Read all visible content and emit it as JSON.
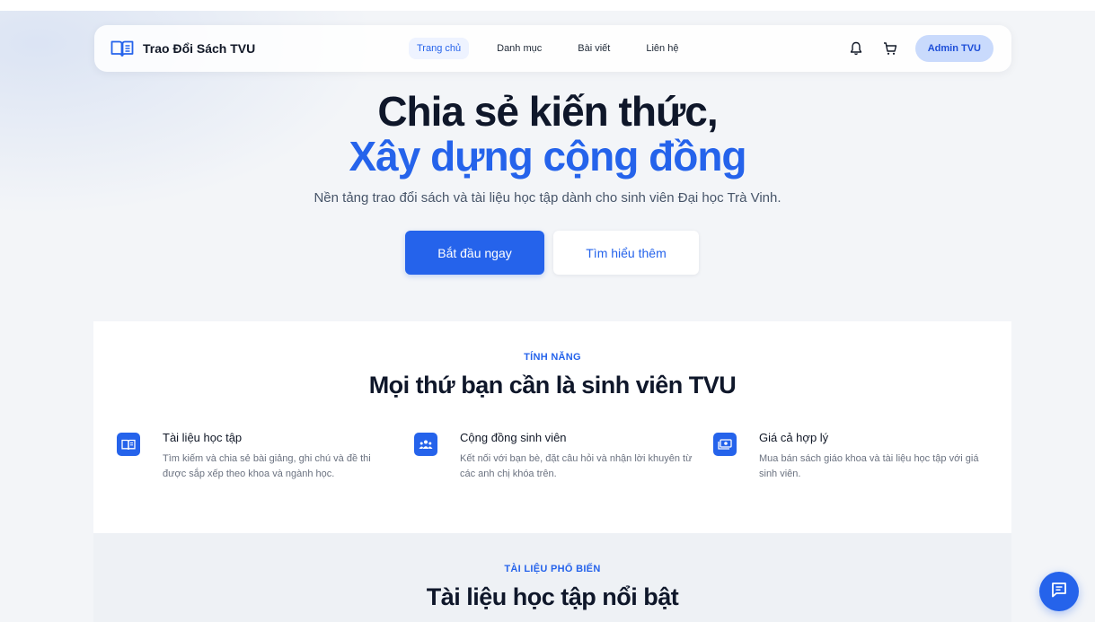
{
  "brand": {
    "name": "Trao Đổi Sách TVU",
    "icon": "book-open-icon"
  },
  "nav": {
    "links": [
      {
        "label": "Trang chủ",
        "active": true
      },
      {
        "label": "Danh mục",
        "active": false
      },
      {
        "label": "Bài viết",
        "active": false
      },
      {
        "label": "Liên hệ",
        "active": false
      }
    ],
    "notification_icon": "bell-icon",
    "cart_icon": "cart-icon",
    "user_label": "Admin TVU"
  },
  "hero": {
    "title_line1": "Chia sẻ kiến thức,",
    "title_line2": "Xây dựng cộng đồng",
    "subtitle": "Nền tảng trao đổi sách và tài liệu học tập dành cho sinh viên Đại học Trà Vinh.",
    "primary_button": "Bắt đầu ngay",
    "secondary_button": "Tìm hiểu thêm"
  },
  "features": {
    "eyebrow": "TÍNH NĂNG",
    "title": "Mọi thứ bạn cần là sinh viên TVU",
    "items": [
      {
        "icon": "book-icon",
        "title": "Tài liệu học tập",
        "desc": "Tìm kiếm và chia sẻ bài giảng, ghi chú và đề thi được sắp xếp theo khoa và ngành học."
      },
      {
        "icon": "users-icon",
        "title": "Cộng đồng sinh viên",
        "desc": "Kết nối với bạn bè, đặt câu hỏi và nhận lời khuyên từ các anh chị khóa trên."
      },
      {
        "icon": "money-icon",
        "title": "Giá cả hợp lý",
        "desc": "Mua bán sách giáo khoa và tài liệu học tập với giá sinh viên."
      }
    ]
  },
  "popular": {
    "eyebrow": "TÀI LIỆU PHỔ BIẾN",
    "title": "Tài liệu học tập nổi bật"
  },
  "chat": {
    "icon": "chat-icon"
  },
  "colors": {
    "accent": "#2563eb",
    "text_dark": "#0f172a",
    "muted": "#6b7280",
    "pill_bg": "#c9dafc"
  }
}
